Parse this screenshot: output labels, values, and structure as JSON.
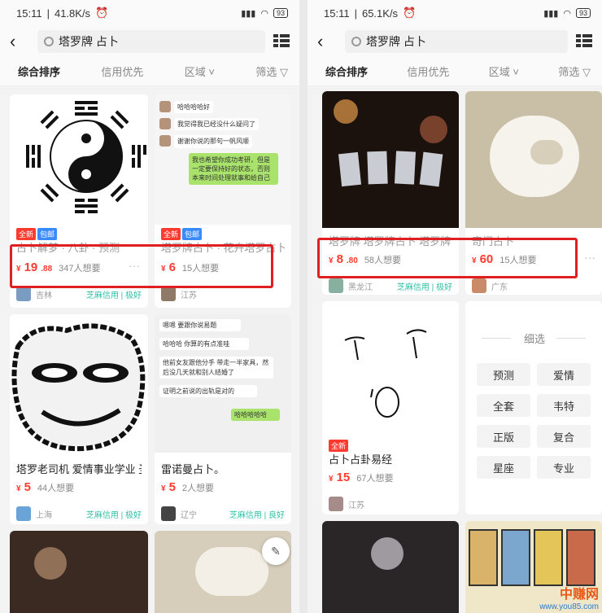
{
  "left": {
    "status": {
      "time": "15:11",
      "speed": "41.8K/s",
      "battery": "93"
    },
    "search": {
      "query": "塔罗牌 占卜"
    },
    "filters": [
      "综合排序",
      "信用优先",
      "区域",
      "筛选"
    ],
    "cards": [
      {
        "title": "占卜解梦 · 八卦 · 预测",
        "tags": [
          "全新",
          "包邮"
        ],
        "price": "19",
        "price_dec": ".88",
        "want": "347人想要",
        "location": "吉林",
        "credit": "芝麻信用 | 极好"
      },
      {
        "title": "塔罗牌占卜 · 花卉塔罗占卜",
        "tags": [
          "全新",
          "包邮"
        ],
        "price": "6",
        "price_dec": "",
        "want": "15人想要",
        "location": "江苏",
        "credit": ""
      },
      {
        "title": "塔罗老司机 爱情事业学业 圣",
        "price": "5",
        "want": "44人想要",
        "location": "上海",
        "credit": "芝麻信用 | 极好"
      },
      {
        "title": "雷诺曼占卜。",
        "price": "5",
        "want": "2人想要",
        "location": "辽宁",
        "credit": "芝麻信用 | 良好"
      }
    ],
    "chat1": [
      "哈哈哈哈好",
      "我觉得我已经没什么疑问了",
      "谢谢你说的那句一帆风顺",
      "我也希望你成功考研，但是一定要保持好的状态，否则本来时间处理就事和给自己"
    ],
    "chat2": [
      "嗯嗯 要跟你说易题",
      "哈哈哈 你算的有点准哇",
      "他前女友跟他分手 带走一半家具，然后没几天就和别人结婚了",
      "证明之前说的出轨是对的",
      "哈哈哈哈哈"
    ]
  },
  "right": {
    "status": {
      "time": "15:11",
      "speed": "65.1K/s",
      "battery": "93"
    },
    "search": {
      "query": "塔罗牌 占卜"
    },
    "filters": [
      "综合排序",
      "信用优先",
      "区域",
      "筛选"
    ],
    "cards": [
      {
        "title": "塔罗牌 塔罗牌占卜 塔罗牌",
        "price": "8",
        "price_dec": ".80",
        "want": "58人想要",
        "location": "黑龙江",
        "credit": "芝麻信用 | 极好"
      },
      {
        "title": "奇门占卜",
        "price": "60",
        "want": "15人想要",
        "location": "广东"
      },
      {
        "title": "占卜占卦易经",
        "tags": [
          "全新"
        ],
        "price": "15",
        "want": "67人想要",
        "location": "江苏"
      }
    ],
    "refine": {
      "title": "细选",
      "chips": [
        "预测",
        "爱情",
        "全套",
        "韦特",
        "正版",
        "复合",
        "星座",
        "专业"
      ]
    }
  },
  "watermark": {
    "line1": "中赚网",
    "line2": "www.you85.com"
  },
  "currency": "¥",
  "colors": {
    "accent": "#ff3b30",
    "highlight": "#e02020",
    "credit": "#2dbfa5"
  }
}
